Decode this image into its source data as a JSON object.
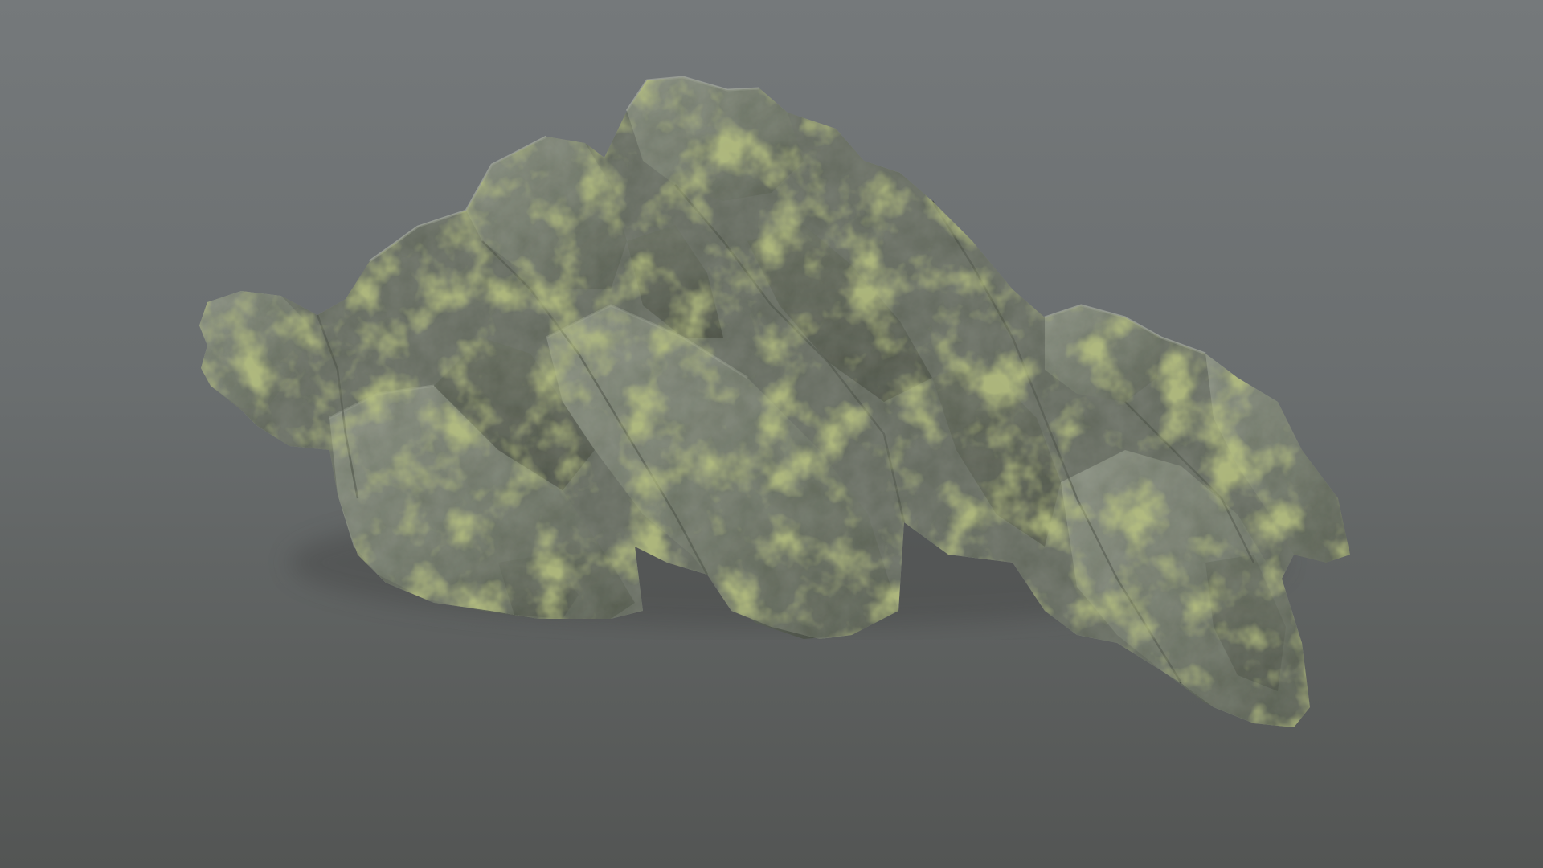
{
  "scene": {
    "background_top": "#75797b",
    "background_bottom": "#535554",
    "rock_base": "#5f645d",
    "rock_highlight": "#9aa094",
    "rock_shadow": "#2c302a",
    "moss_color": "#7c8a3a"
  }
}
